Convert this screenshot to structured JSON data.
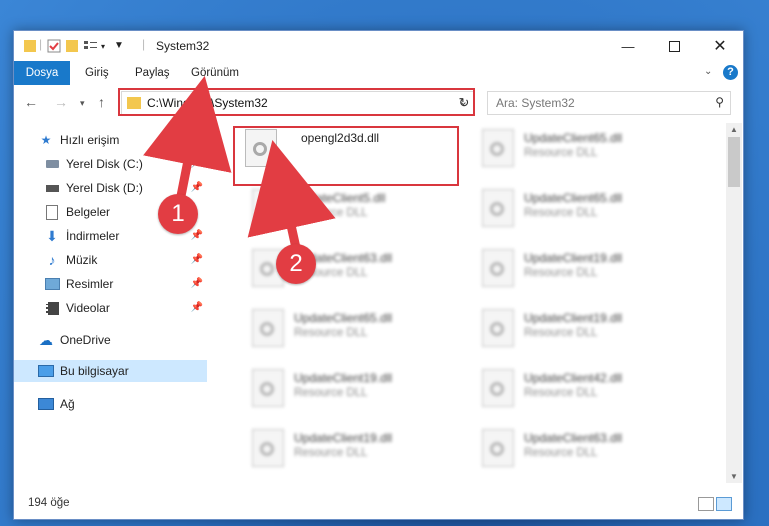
{
  "window": {
    "title": "System32"
  },
  "ribbon": {
    "tabs": [
      "Dosya",
      "Giriş",
      "Paylaş",
      "Görünüm"
    ]
  },
  "address": {
    "path": "C:\\Windows\\System32"
  },
  "search": {
    "placeholder": "Ara: System32"
  },
  "nav": {
    "items": [
      {
        "label": "Hızlı erişim",
        "icon": "star-icon"
      },
      {
        "label": "Yerel Disk (C:)",
        "icon": "drive-icon"
      },
      {
        "label": "Yerel Disk (D:)",
        "icon": "drive-icon"
      },
      {
        "label": "Belgeler",
        "icon": "documents-icon"
      },
      {
        "label": "İndirmeler",
        "icon": "download-icon"
      },
      {
        "label": "Müzik",
        "icon": "music-icon"
      },
      {
        "label": "Resimler",
        "icon": "pictures-icon"
      },
      {
        "label": "Videolar",
        "icon": "videos-icon"
      },
      {
        "label": "OneDrive",
        "icon": "cloud-icon"
      },
      {
        "label": "Bu bilgisayar",
        "icon": "computer-icon"
      },
      {
        "label": "Ağ",
        "icon": "network-icon"
      }
    ]
  },
  "files": [
    {
      "name": "opengl2d3d.dll",
      "type": ""
    },
    {
      "name": "UpdateClient65.dll",
      "type": "Resource DLL"
    },
    {
      "name": "UpdateClient5.dll",
      "type": "Resource DLL"
    },
    {
      "name": "UpdateClient65.dll",
      "type": "Resource DLL"
    },
    {
      "name": "UpdateClient63.dll",
      "type": "Resource DLL"
    },
    {
      "name": "UpdateClient19.dll",
      "type": "Resource DLL"
    },
    {
      "name": "UpdateClient65.dll",
      "type": "Resource DLL"
    },
    {
      "name": "UpdateClient19.dll",
      "type": "Resource DLL"
    },
    {
      "name": "UpdateClient19.dll",
      "type": "Resource DLL"
    },
    {
      "name": "UpdateClient42.dll",
      "type": "Resource DLL"
    },
    {
      "name": "UpdateClient19.dll",
      "type": "Resource DLL"
    },
    {
      "name": "UpdateClient63.dll",
      "type": "Resource DLL"
    }
  ],
  "status": {
    "count": "194 öğe"
  },
  "annotations": {
    "one": "1",
    "two": "2"
  },
  "colors": {
    "accent": "#1979ca",
    "annotation": "#e23d43"
  }
}
